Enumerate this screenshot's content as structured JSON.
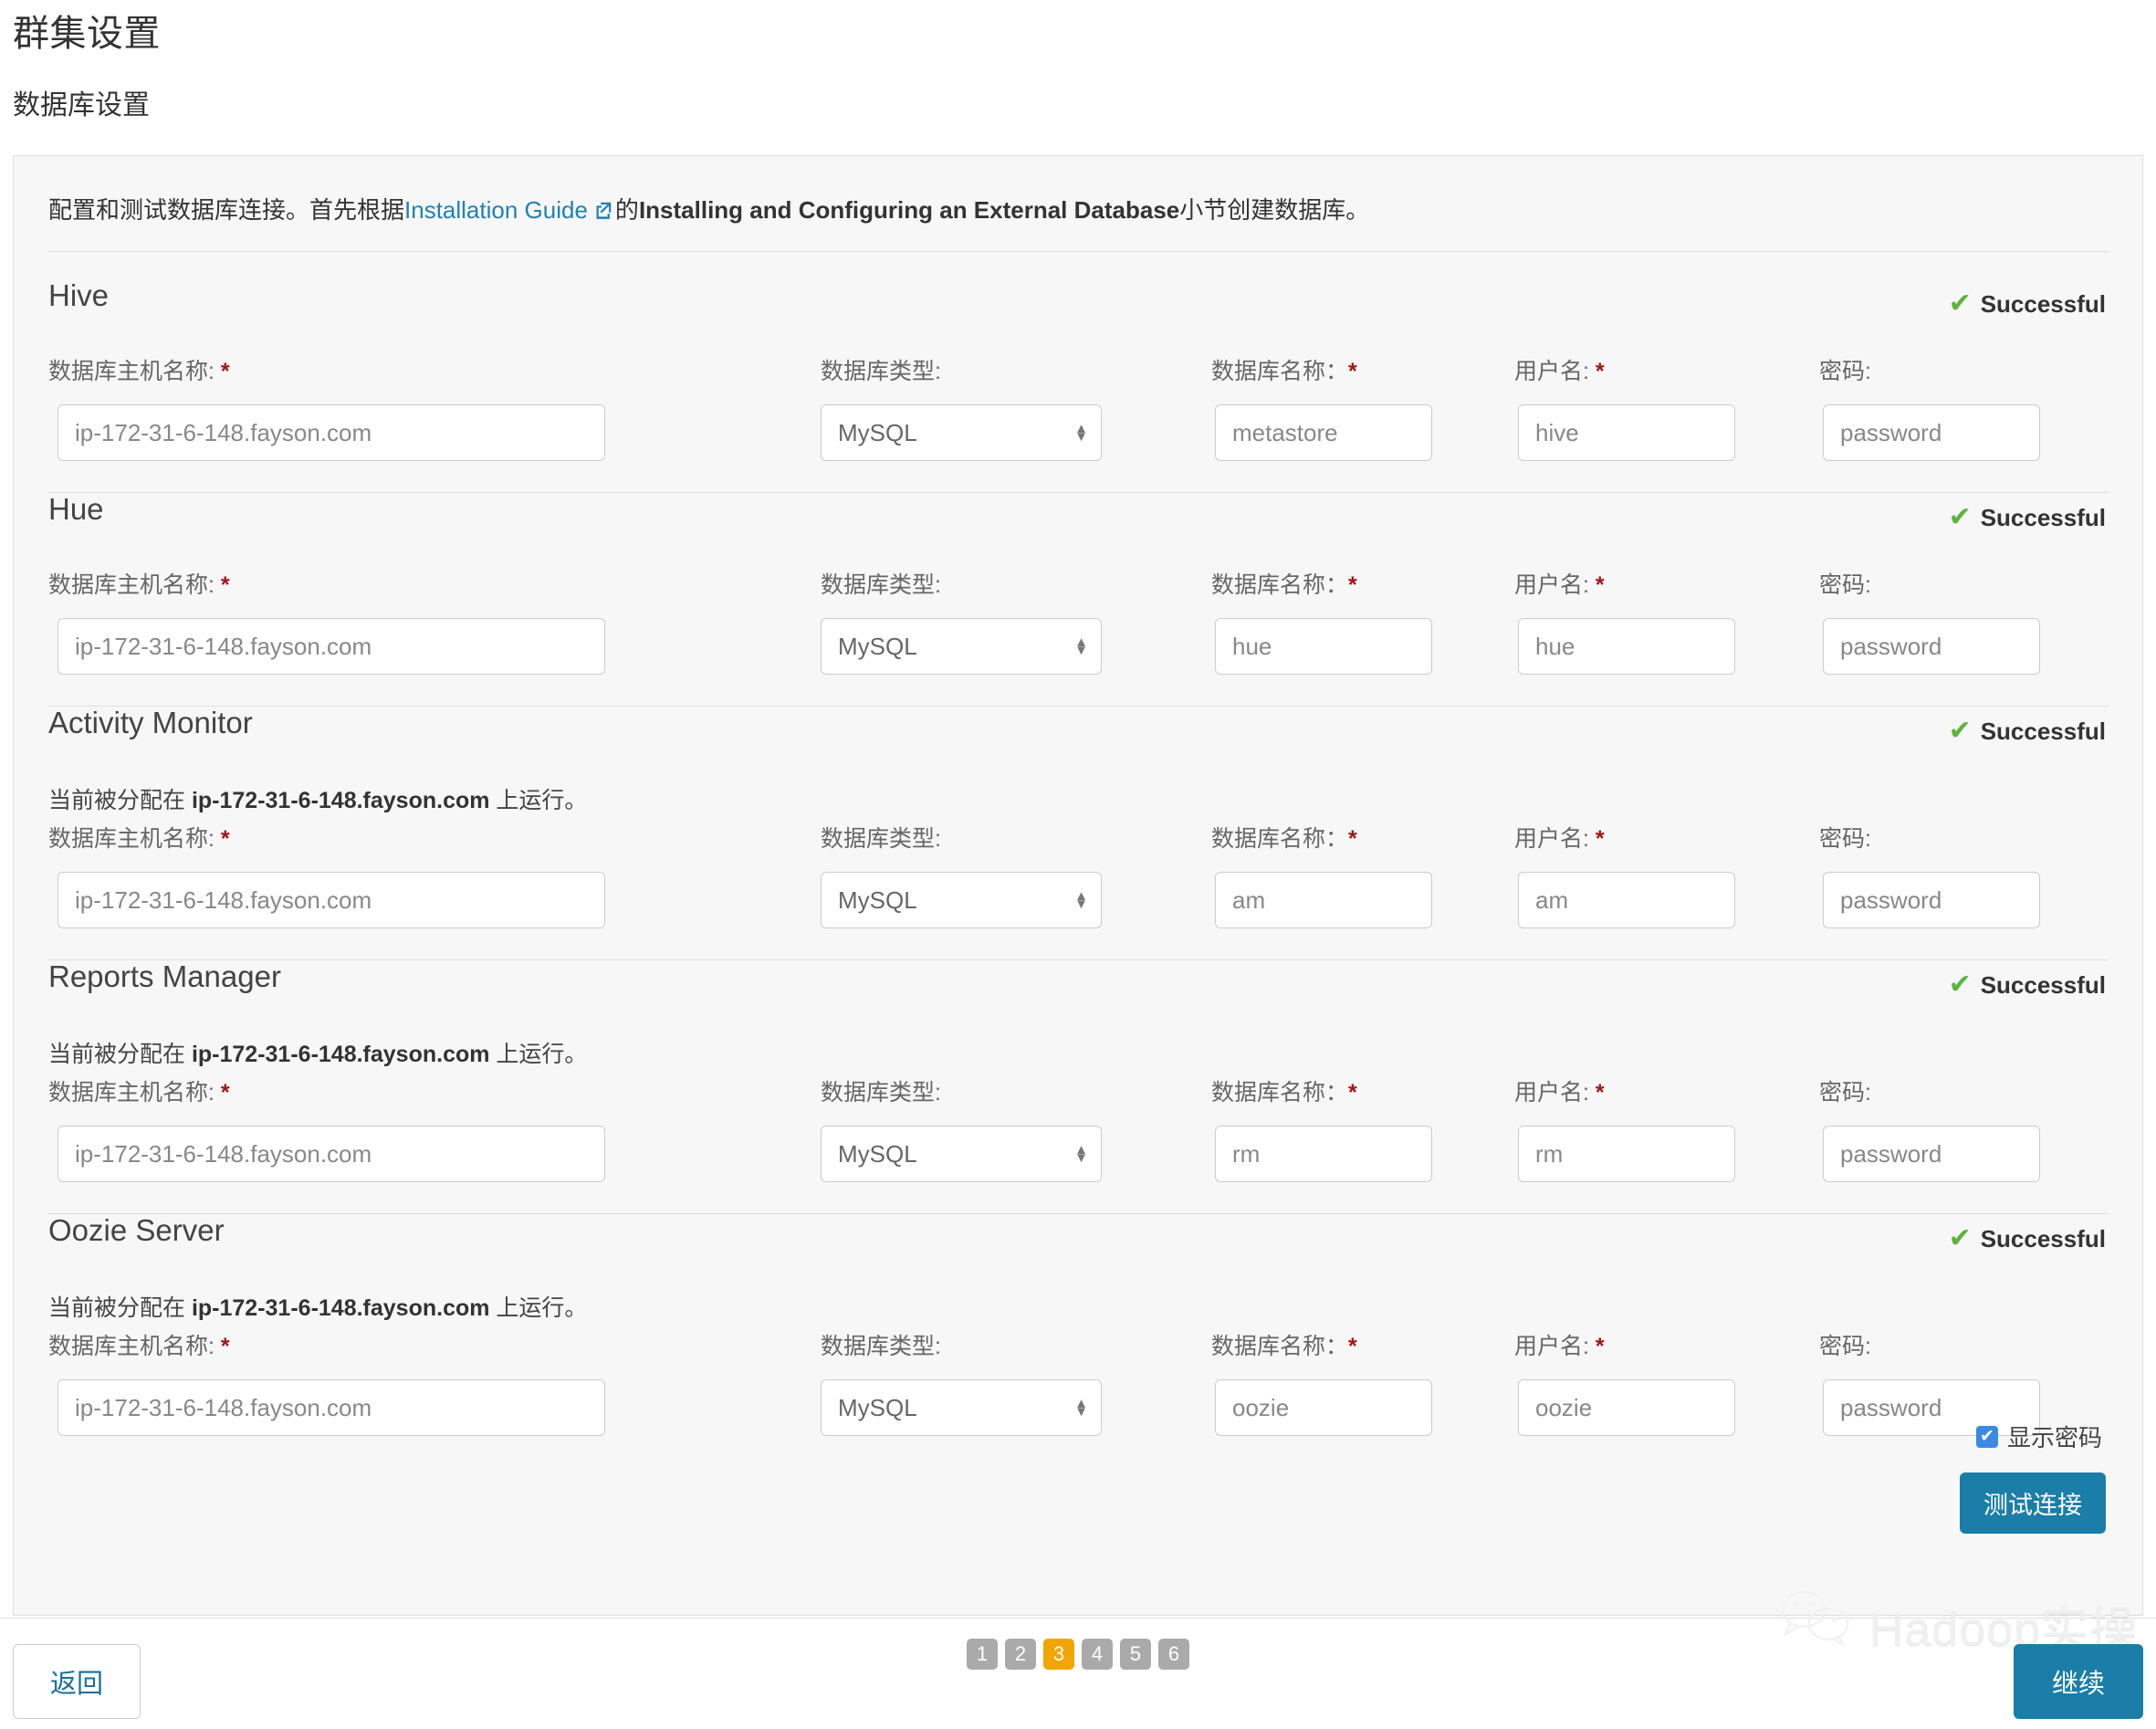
{
  "header": {
    "title": "群集设置",
    "subtitle": "数据库设置"
  },
  "intro": {
    "prefix": "配置和测试数据库连接。首先根据",
    "link_text": "Installation Guide",
    "link_icon": "external-link-icon",
    "middle": "的",
    "bold_text": "Installing and Configuring an External Database",
    "suffix": "小节创建数据库。"
  },
  "labels": {
    "host": "数据库主机名称:",
    "db_type": "数据库类型:",
    "db_name": "数据库名称：",
    "username": "用户名:",
    "password": "密码:",
    "required_marker": "*"
  },
  "status_label": "Successful",
  "assigned_prefix": "当前被分配在 ",
  "assigned_suffix": " 上运行。",
  "sections": [
    {
      "name": "Hive",
      "status": "Successful",
      "assigned_host": null,
      "host": "ip-172-31-6-148.fayson.com",
      "db_type": "MySQL",
      "db_name": "metastore",
      "username": "hive",
      "password": "password"
    },
    {
      "name": "Hue",
      "status": "Successful",
      "assigned_host": null,
      "host": "ip-172-31-6-148.fayson.com",
      "db_type": "MySQL",
      "db_name": "hue",
      "username": "hue",
      "password": "password"
    },
    {
      "name": "Activity Monitor",
      "status": "Successful",
      "assigned_host": "ip-172-31-6-148.fayson.com",
      "host": "ip-172-31-6-148.fayson.com",
      "db_type": "MySQL",
      "db_name": "am",
      "username": "am",
      "password": "password"
    },
    {
      "name": "Reports Manager",
      "status": "Successful",
      "assigned_host": "ip-172-31-6-148.fayson.com",
      "host": "ip-172-31-6-148.fayson.com",
      "db_type": "MySQL",
      "db_name": "rm",
      "username": "rm",
      "password": "password"
    },
    {
      "name": "Oozie Server",
      "status": "Successful",
      "assigned_host": "ip-172-31-6-148.fayson.com",
      "host": "ip-172-31-6-148.fayson.com",
      "db_type": "MySQL",
      "db_name": "oozie",
      "username": "oozie",
      "password": "password"
    }
  ],
  "show_password": {
    "label": "显示密码",
    "checked": true
  },
  "test_button": "测试连接",
  "footer": {
    "back": "返回",
    "continue": "继续",
    "pages": [
      "1",
      "2",
      "3",
      "4",
      "5",
      "6"
    ],
    "active_page": "3"
  },
  "watermark": {
    "text": "Hadoop实操",
    "icon": "wechat-icon"
  },
  "colors": {
    "accent": "#1b7ea8",
    "link": "#1f82b0",
    "success": "#5bb53b",
    "active_page": "#f0a500",
    "checkbox": "#3b8ae2"
  }
}
